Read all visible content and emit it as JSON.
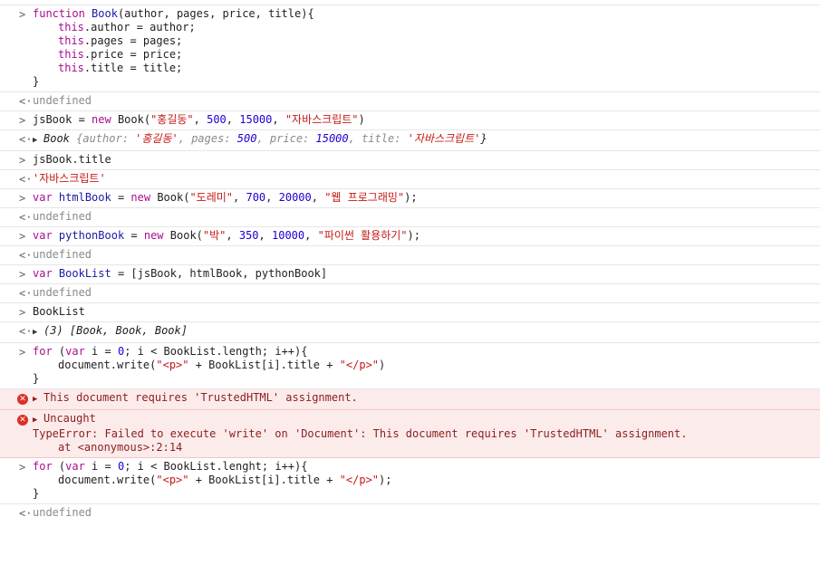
{
  "console": {
    "prompts": {
      "input": ">",
      "output": "<·"
    },
    "entries": {
      "e1": {
        "l1": {
          "kw": "function",
          "name": "Book",
          "rest": "(author, pages, price, title){"
        },
        "l2": {
          "kw": "this",
          "rest": ".author = author;"
        },
        "l3": {
          "kw": "this",
          "rest": ".pages = pages;"
        },
        "l4": {
          "kw": "this",
          "rest": ".price = price;"
        },
        "l5": {
          "kw": "this",
          "rest": ".title = title;"
        },
        "l6": "}"
      },
      "o1": "undefined",
      "e2": {
        "a": "jsBook = ",
        "kw": "new",
        "b": " Book(",
        "s1": "\"홍길동\"",
        "c1": ", ",
        "n1": "500",
        "c2": ", ",
        "n2": "15000",
        "c3": ", ",
        "s2": "\"자바스크립트\"",
        "end": ")"
      },
      "o2": {
        "type": "Book",
        "open": " {",
        "k1": "author",
        "v1": "'홍길동'",
        "k2": "pages",
        "v2": "500",
        "k3": "price",
        "v3": "15000",
        "k4": "title",
        "v4": "'자바스크립트'",
        "close": "}"
      },
      "e3": "jsBook.title",
      "o3": "'자바스크립트'",
      "e4": {
        "kw": "var",
        "a": " ",
        "name": "htmlBook",
        "b": " = ",
        "kw2": "new",
        "c": " Book(",
        "s1": "\"도레미\"",
        "c1": ", ",
        "n1": "700",
        "c2": ", ",
        "n2": "20000",
        "c3": ", ",
        "s2": "\"웹 프로그래밍\"",
        "end": ");"
      },
      "o4": "undefined",
      "e5": {
        "kw": "var",
        "a": " ",
        "name": "pythonBook",
        "b": " = ",
        "kw2": "new",
        "c": " Book(",
        "s1": "\"박\"",
        "c1": ", ",
        "n1": "350",
        "c2": ", ",
        "n2": "10000",
        "c3": ", ",
        "s2": "\"파이썬 활용하기\"",
        "end": ");"
      },
      "o5": "undefined",
      "e6": {
        "kw": "var",
        "a": " ",
        "name": "BookList",
        "b": " = [jsBook, htmlBook, pythonBook]"
      },
      "o6": "undefined",
      "e7": "BookList",
      "o7": {
        "count": "(3)",
        "items": "[Book, Book, Book]"
      },
      "e8": {
        "l1": {
          "kw": "for",
          "a": " (",
          "kw2": "var",
          "b": " i = ",
          "n": "0",
          "c": "; i < BookList.length; i++){"
        },
        "l2": {
          "a": "document.write(",
          "s1": "\"<p>\"",
          "b": " + BookList[i].title + ",
          "s2": "\"</p>\"",
          "c": ")"
        },
        "l3": "}"
      },
      "err1": "This document requires 'TrustedHTML' assignment.",
      "err2": {
        "head": "Uncaught",
        "msg": "TypeError: Failed to execute 'write' on 'Document': This document requires 'TrustedHTML' assignment.",
        "at": "at <anonymous>:2:14"
      },
      "e9": {
        "l1": {
          "kw": "for",
          "a": " (",
          "kw2": "var",
          "b": " i = ",
          "n": "0",
          "c": "; i < BookList.lenght; i++){"
        },
        "l2": {
          "a": "document.write(",
          "s1": "\"<p>\"",
          "b": " + BookList[i].title + ",
          "s2": "\"</p>\"",
          "c": ");"
        },
        "l3": "}"
      },
      "o9": "undefined"
    }
  }
}
